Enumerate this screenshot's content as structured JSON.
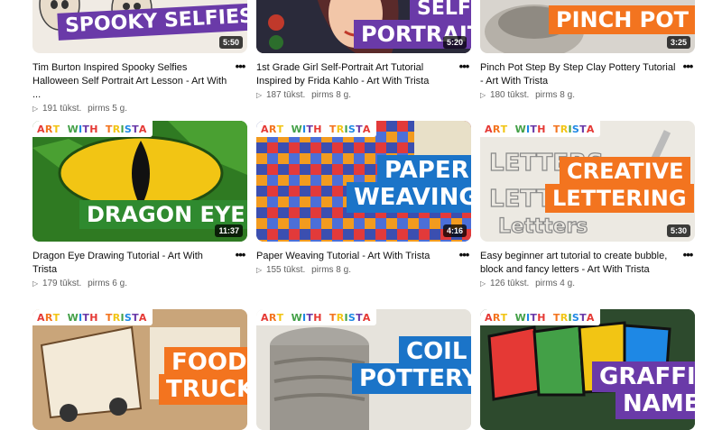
{
  "videos": [
    {
      "title": "Tim Burton Inspired Spooky Selfies Halloween Self Portrait Art Lesson - Art With ...",
      "views": "191 tūkst.",
      "age": "pirms 5 g.",
      "duration": "5:50",
      "overlay": "SPOOKY SELFIES"
    },
    {
      "title": "1st Grade Girl Self-Portrait Art Tutorial Inspired by Frida Kahlo - Art With Trista",
      "views": "187 tūkst.",
      "age": "pirms 8 g.",
      "duration": "5:20",
      "overlay": "PORTRAIT",
      "overlay_top": "SELF"
    },
    {
      "title": "Pinch Pot Step By Step Clay Pottery Tutorial - Art With Trista",
      "views": "180 tūkst.",
      "age": "pirms 8 g.",
      "duration": "3:25",
      "overlay": "PINCH POT"
    },
    {
      "title": "Dragon Eye Drawing Tutorial - Art With Trista",
      "views": "179 tūkst.",
      "age": "pirms 6 g.",
      "duration": "11:37",
      "overlay": "DRAGON EYE",
      "brand": "ART WITH TRISTA"
    },
    {
      "title": "Paper Weaving Tutorial - Art With Trista",
      "views": "155 tūkst.",
      "age": "pirms 8 g.",
      "duration": "4:16",
      "overlay": "PAPER",
      "overlay2": "WEAVING",
      "brand": "ART WITH TRISTA"
    },
    {
      "title": "Easy beginner art tutorial to create bubble, block and fancy letters - Art With Trista",
      "views": "126 tūkst.",
      "age": "pirms 4 g.",
      "duration": "5:30",
      "overlay": "CREATIVE",
      "overlay2": "LETTERING",
      "brand": "ART WITH TRISTA"
    },
    {
      "overlay": "FOOD",
      "overlay2": "TRUCK",
      "brand": "ART WITH TRISTA"
    },
    {
      "overlay": "COIL",
      "overlay2": "POTTERY",
      "brand": "ART WITH TRISTA"
    },
    {
      "overlay": "GRAFFITI",
      "overlay2": "NAME",
      "brand": "ART WITH TRISTA"
    }
  ],
  "colors": {
    "purple": "#6a3aa8",
    "orange": "#f3741f",
    "blue": "#1b74c8",
    "green": "#2f8a2f"
  },
  "icons": {
    "more": "more-vert-icon",
    "play": "play-icon"
  }
}
